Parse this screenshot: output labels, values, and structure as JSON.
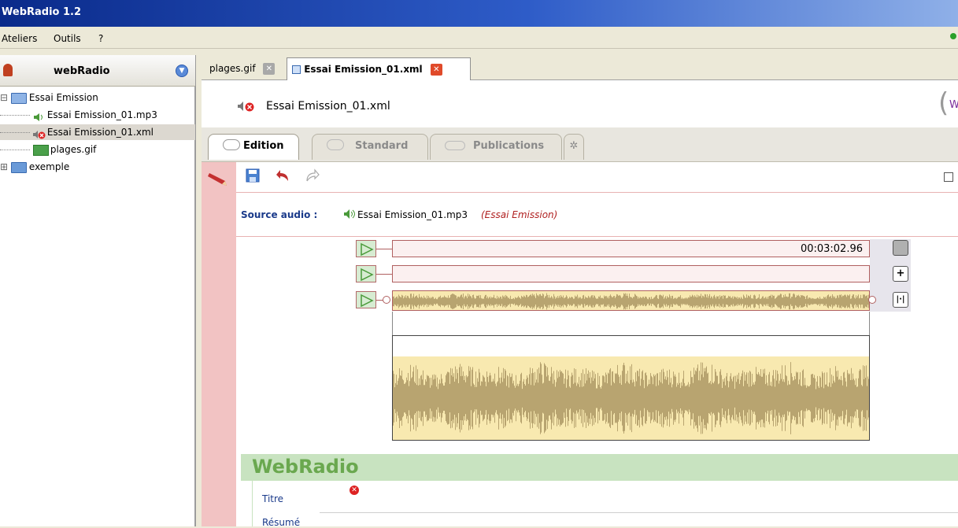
{
  "window": {
    "title": "WebRadio 1.2"
  },
  "menu": {
    "items": [
      "Ateliers",
      "Outils",
      "?"
    ]
  },
  "left_panel": {
    "header": "webRadio",
    "tree": [
      {
        "label": "Essai Emission",
        "level": 0,
        "type": "folder-open"
      },
      {
        "label": "Essai Emission_01.mp3",
        "level": 1,
        "type": "audio"
      },
      {
        "label": "Essai Emission_01.xml",
        "level": 1,
        "type": "xml",
        "selected": true
      },
      {
        "label": "plages.gif",
        "level": 1,
        "type": "image"
      },
      {
        "label": "exemple",
        "level": 0,
        "type": "folder"
      }
    ]
  },
  "doc_tabs": [
    {
      "label": "plages.gif",
      "active": false
    },
    {
      "label": "Essai Emission_01.xml",
      "active": true
    }
  ],
  "document": {
    "title": "Essai Emission_01.xml",
    "right_fragment": "W"
  },
  "sub_tabs": [
    {
      "label": "Edition",
      "active": true
    },
    {
      "label": "Standard",
      "active": false
    },
    {
      "label": "Publications",
      "active": false
    }
  ],
  "editor": {
    "source_label": "Source audio :",
    "source_file": "Essai Emission_01.mp3",
    "source_context": "(Essai Emission)",
    "time_display": "00:03:02.96",
    "section_title": "WebRadio",
    "fields": [
      "Titre",
      "Résumé"
    ]
  },
  "colors": {
    "accent_pink": "#f2c3c3",
    "waveform": "#b8a470",
    "waveform_bg": "#f8e9b0",
    "section_green": "#6aa84f",
    "band_green": "#c8e3c0"
  }
}
